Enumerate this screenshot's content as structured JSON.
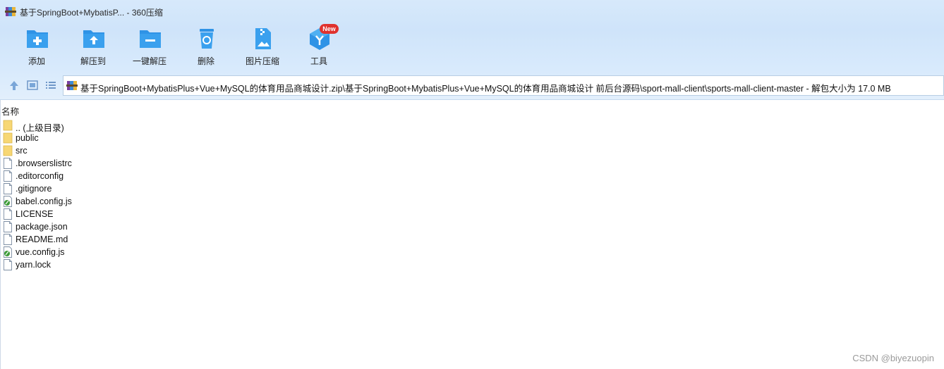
{
  "window": {
    "title": "基于SpringBoot+MybatisP... - 360压缩",
    "app_icon": "winrar-archive-icon"
  },
  "toolbar": {
    "items": [
      {
        "label": "添加",
        "icon": "add-folder-icon"
      },
      {
        "label": "解压到",
        "icon": "extract-to-icon"
      },
      {
        "label": "一键解压",
        "icon": "one-click-extract-icon"
      },
      {
        "label": "删除",
        "icon": "delete-bin-icon"
      },
      {
        "label": "图片压缩",
        "icon": "image-compress-icon"
      },
      {
        "label": "工具",
        "icon": "tools-cube-icon",
        "badge": "New"
      }
    ]
  },
  "address": {
    "path": "基于SpringBoot+MybatisPlus+Vue+MySQL的体育用品商城设计.zip\\基于SpringBoot+MybatisPlus+Vue+MySQL的体育用品商城设计 前后台源码\\sport-mall-client\\sports-mall-client-master - 解包大小为 17.0 MB"
  },
  "list": {
    "column_name": "名称",
    "files": [
      {
        "name": ".. (上级目录)",
        "type": "folder"
      },
      {
        "name": "public",
        "type": "folder"
      },
      {
        "name": "src",
        "type": "folder"
      },
      {
        "name": ".browserslistrc",
        "type": "file"
      },
      {
        "name": ".editorconfig",
        "type": "file"
      },
      {
        "name": ".gitignore",
        "type": "file"
      },
      {
        "name": "babel.config.js",
        "type": "js"
      },
      {
        "name": "LICENSE",
        "type": "file"
      },
      {
        "name": "package.json",
        "type": "file"
      },
      {
        "name": "README.md",
        "type": "file"
      },
      {
        "name": "vue.config.js",
        "type": "js"
      },
      {
        "name": "yarn.lock",
        "type": "file"
      }
    ]
  },
  "watermark": "CSDN @biyezuopin",
  "colors": {
    "toolbar_icon_blue": "#2f93e6",
    "badge_red": "#e0322e",
    "folder_yellow": "#f7d774"
  }
}
